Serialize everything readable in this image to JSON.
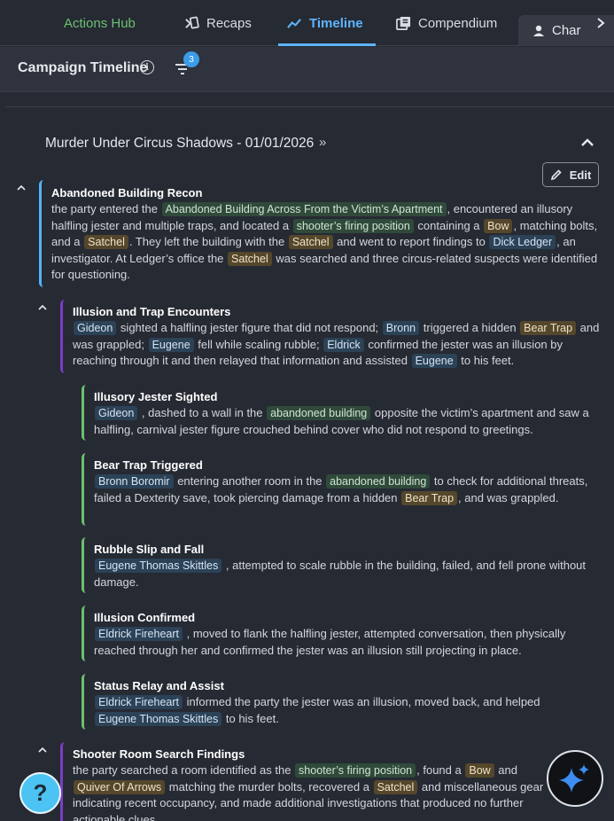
{
  "nav": {
    "hub": "Actions Hub",
    "tabs": [
      {
        "label": "Recaps",
        "icon": "recaps-icon"
      },
      {
        "label": "Timeline",
        "icon": "timeline-icon"
      },
      {
        "label": "Compendium",
        "icon": "compendium-icon"
      }
    ],
    "char_tab": "Char",
    "accent": "#5db4ff"
  },
  "header": {
    "title": "Campaign Timeline",
    "filter_count": "3"
  },
  "session": {
    "title": "Murder Under Circus Shadows - 01/01/2026",
    "edit_label": "Edit"
  },
  "events": [
    {
      "title": "Abandoned Building Recon",
      "body": [
        {
          "t": "the party entered the "
        },
        {
          "c": "loc",
          "t": "Abandoned Building Across From the Victim’s Apartment"
        },
        {
          "t": ", encountered an illusory halfling jester and multiple traps, and located a "
        },
        {
          "c": "loc",
          "t": "shooter’s firing position"
        },
        {
          "t": " containing a "
        },
        {
          "c": "item",
          "t": "Bow"
        },
        {
          "t": ", matching bolts, and a "
        },
        {
          "c": "item",
          "t": "Satchel"
        },
        {
          "t": ". They left the building with the "
        },
        {
          "c": "item",
          "t": "Satchel"
        },
        {
          "t": " and went to report findings to "
        },
        {
          "c": "char",
          "t": "Dick Ledger"
        },
        {
          "t": ", an investigator. At Ledger’s office the "
        },
        {
          "c": "item",
          "t": "Satchel"
        },
        {
          "t": " was searched and three circus-related suspects were identified for questioning."
        }
      ]
    },
    {
      "title": "Illusion and Trap Encounters",
      "body": [
        {
          "c": "char",
          "t": "Gideon"
        },
        {
          "t": " sighted a halfling jester figure that did not respond; "
        },
        {
          "c": "char",
          "t": "Bronn"
        },
        {
          "t": " triggered a hidden "
        },
        {
          "c": "item",
          "t": "Bear Trap"
        },
        {
          "t": " and was grappled; "
        },
        {
          "c": "char",
          "t": "Eugene"
        },
        {
          "t": " fell while scaling rubble; "
        },
        {
          "c": "char",
          "t": "Eldrick"
        },
        {
          "t": " confirmed the jester was an illusion by reaching through it and then relayed that information and assisted "
        },
        {
          "c": "char",
          "t": "Eugene"
        },
        {
          "t": " to his feet."
        }
      ]
    },
    {
      "title": "Illusory Jester Sighted",
      "body": [
        {
          "c": "char",
          "t": "Gideon"
        },
        {
          "t": " , dashed to a wall in the "
        },
        {
          "c": "loc",
          "t": "abandoned building"
        },
        {
          "t": " opposite the victim’s apartment and saw a halfling, carnival jester figure crouched behind cover who did not respond to greetings."
        }
      ]
    },
    {
      "title": "Bear Trap Triggered",
      "body": [
        {
          "c": "char",
          "t": "Bronn Boromir"
        },
        {
          "t": " entering another room in the "
        },
        {
          "c": "loc",
          "t": "abandoned building"
        },
        {
          "t": " to check for additional threats, failed a Dexterity save, took piercing damage from a hidden "
        },
        {
          "c": "item",
          "t": "Bear Trap"
        },
        {
          "t": ", and was grappled."
        }
      ]
    },
    {
      "title": "Rubble Slip and Fall",
      "body": [
        {
          "c": "char",
          "t": "Eugene Thomas Skittles"
        },
        {
          "t": " , attempted to scale rubble in the building, failed, and fell prone without damage."
        }
      ]
    },
    {
      "title": "Illusion Confirmed",
      "body": [
        {
          "c": "char",
          "t": "Eldrick Fireheart"
        },
        {
          "t": " , moved to flank the halfling jester, attempted conversation, then physically reached through her and confirmed the jester was an illusion still projecting in place."
        }
      ]
    },
    {
      "title": "Status Relay and Assist",
      "body": [
        {
          "c": "char",
          "t": "Eldrick Fireheart"
        },
        {
          "t": " informed the party the jester was an illusion, moved back, and helped "
        },
        {
          "c": "char",
          "t": "Eugene Thomas Skittles"
        },
        {
          "t": " to his feet."
        }
      ]
    },
    {
      "title": "Shooter Room Search Findings",
      "body": [
        {
          "t": "the party searched a room identified as the "
        },
        {
          "c": "loc",
          "t": "shooter’s firing position"
        },
        {
          "t": ", found a "
        },
        {
          "c": "item",
          "t": "Bow"
        },
        {
          "t": " and "
        },
        {
          "c": "item",
          "t": "Quiver Of Arrows"
        },
        {
          "t": " matching the murder bolts, recovered a "
        },
        {
          "c": "item",
          "t": "Satchel"
        },
        {
          "t": " and miscellaneous gear indicating recent occupancy, and made additional investigations that produced no further actionable clues."
        }
      ]
    }
  ],
  "help_label": "?",
  "colors": {
    "location_chip": "#2f4a3a",
    "item_chip": "#55472c",
    "character_chip": "#2b4257",
    "level0": "#4fb5f5",
    "level1": "#7b3fc4",
    "level2": "#6cc070"
  }
}
